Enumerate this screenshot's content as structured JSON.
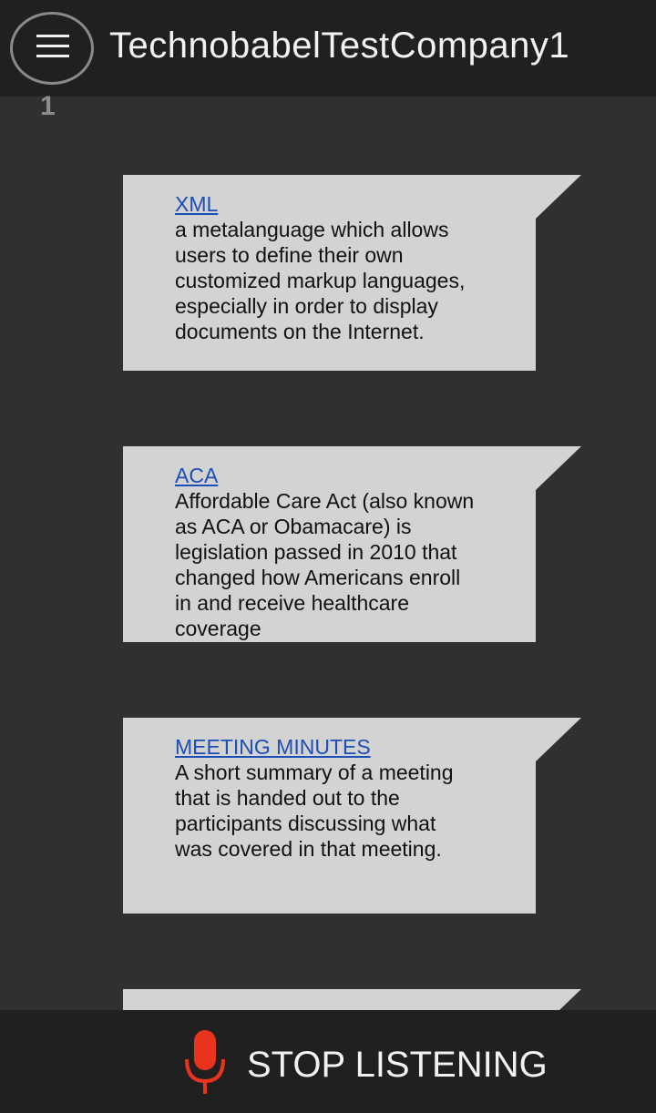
{
  "header": {
    "title": "TechnobabelTestCompany1",
    "badge": "1"
  },
  "cards": [
    {
      "term": "XML",
      "definition": "a metalanguage which allows\nusers to define their own\ncustomized markup languages,\nespecially in order to display\ndocuments on the Internet."
    },
    {
      "term": "ACA",
      "definition": "Affordable Care Act (also known\nas ACA or Obamacare) is\nlegislation passed in 2010 that\nchanged how Americans enroll\nin and receive healthcare\ncoverage"
    },
    {
      "term": "MEETING MINUTES",
      "definition": "A short summary of a meeting\nthat is handed out to the\nparticipants discussing what\nwas covered in that meeting."
    }
  ],
  "footer": {
    "stop_label": "STOP LISTENING"
  },
  "colors": {
    "background": "#303030",
    "bar": "#202020",
    "card": "#d3d3d3",
    "link": "#1c4fb5",
    "mic": "#e8341c"
  },
  "icons": {
    "menu": "hamburger-menu-icon",
    "mic": "microphone-icon"
  }
}
